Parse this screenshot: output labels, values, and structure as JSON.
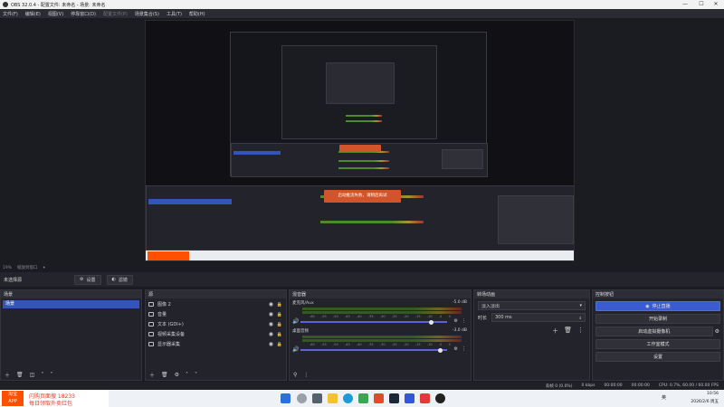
{
  "window": {
    "title": "OBS 32.0.4 - 配置文件: 未命名 - 场景: 未命名",
    "controls": [
      "—",
      "☐",
      "✕"
    ]
  },
  "menu": {
    "items": [
      "文件(F)",
      "编辑(E)",
      "视图(V)",
      "停靠窗口(D)",
      "配置文件(P)",
      "场景集合(S)",
      "工具(T)",
      "帮助(H)"
    ],
    "disabled_index": 4
  },
  "preview": {
    "zoom": "19%",
    "zoom_mode": "缩放到窗口",
    "inner_toast": "启动推流失败，请稍后再试"
  },
  "context_bar": {
    "label": "未选择源",
    "settings_label": "设置",
    "filters_label": "滤镜"
  },
  "scenes": {
    "title": "场景",
    "items": [
      "场景"
    ]
  },
  "sources": {
    "title": "源",
    "items": [
      {
        "label": "图像 2",
        "icon": "image-icon"
      },
      {
        "label": "音量",
        "icon": "image-icon"
      },
      {
        "label": "文本 (GDI+)",
        "icon": "text-icon"
      },
      {
        "label": "视频采集设备",
        "icon": "camera-icon"
      },
      {
        "label": "显示器采集",
        "icon": "monitor-icon"
      }
    ]
  },
  "mixer": {
    "title": "混音器",
    "channels": [
      {
        "name": "麦克风/Aux",
        "db": "-5.0 dB",
        "level": 0.8
      },
      {
        "name": "桌面音频",
        "db": "-3.0 dB",
        "level": 0.86
      }
    ],
    "scale": [
      "-60",
      "-55",
      "-50",
      "-45",
      "-40",
      "-35",
      "-30",
      "-25",
      "-20",
      "-15",
      "-10",
      "-5",
      "0"
    ]
  },
  "transitions": {
    "title": "转场动画",
    "type": "淡入淡出",
    "duration_label": "时长",
    "duration_value": "300 ms"
  },
  "controls": {
    "title": "控制按钮",
    "buttons": [
      "停止直播",
      "开始录制",
      "启动虚拟摄像机",
      "工作室模式",
      "设置"
    ]
  },
  "status": {
    "dropped": "丢帧 0 (0.0%)",
    "bitrate": "0 kbps",
    "stream_time": "00:00:00",
    "rec_time": "00:00:00",
    "cpu": "CPU: 0.7%, 60.00 / 60.00 FPS"
  },
  "taskbar": {
    "ad_logo_1": "淘宝",
    "ad_logo_2": "APP",
    "ad_line_1": "闪购页面搜 18233",
    "ad_line_2": "每日领取外卖红包",
    "lang": "英",
    "time": "10:56",
    "date": "2026/2/6 周五"
  }
}
